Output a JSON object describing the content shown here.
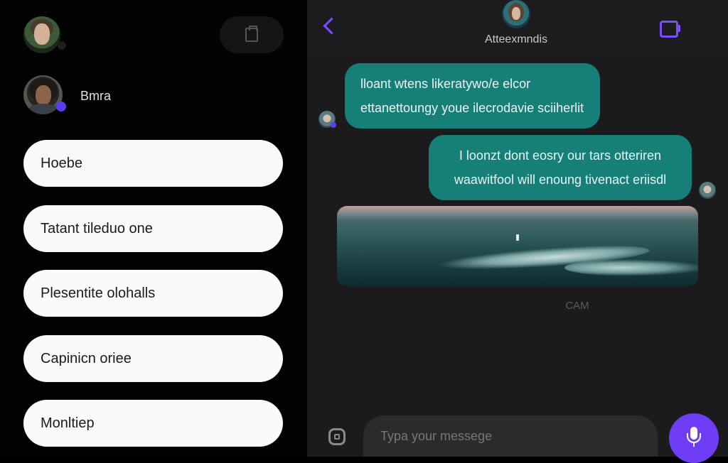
{
  "sidebar": {
    "contact_name": "Bmra",
    "menu": [
      {
        "label": "Hoebe"
      },
      {
        "label": "Tatant tileduo one"
      },
      {
        "label": "Plesentite olohalls"
      },
      {
        "label": "Capinicn oriee"
      },
      {
        "label": "Monltiep"
      }
    ]
  },
  "chat": {
    "title": "Atteexmndis",
    "messages": [
      {
        "line1": "lloant wtens likeratywo/e elcor",
        "line2": "ettanettoungy youe ilecrodavie sciiherlit"
      },
      {
        "line1": "I loonzt dont eosry our tars otteriren",
        "line2": "waawitfool will enoung tivenact eriisdl"
      }
    ],
    "timestamp": "CAM",
    "input_placeholder": "Typa your messege"
  },
  "colors": {
    "accent": "#7b4dff",
    "bubble": "#157f78",
    "mic_button": "#6f3df6"
  },
  "icons": {
    "back": "chevron-left-icon",
    "video": "video-call-icon",
    "attach": "attach-icon",
    "mic": "microphone-icon",
    "clipboard": "clipboard-icon"
  }
}
